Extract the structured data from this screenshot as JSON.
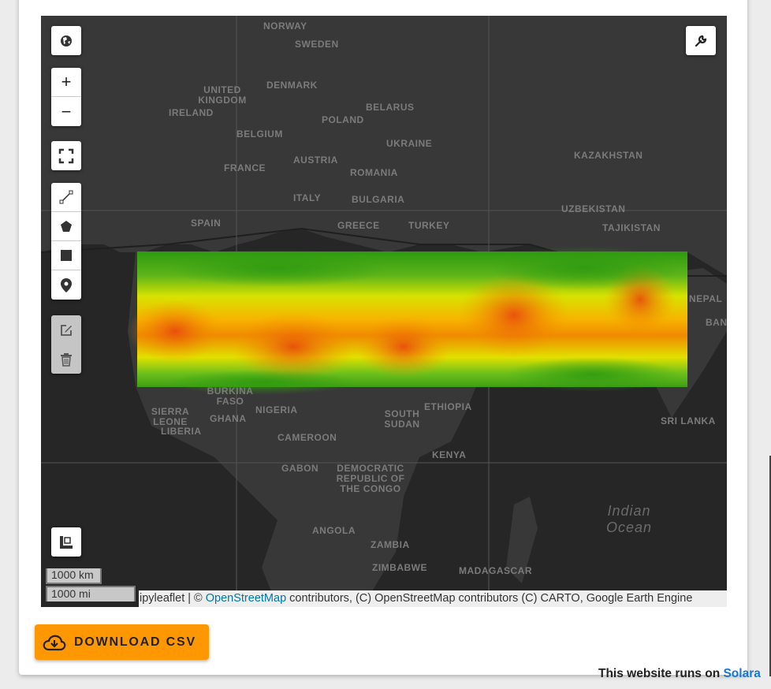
{
  "map": {
    "country_labels": [
      {
        "name": "NORWAY"
      },
      {
        "name": "SWEDEN"
      },
      {
        "name": "UNITED KINGDOM"
      },
      {
        "name": "DENMARK"
      },
      {
        "name": "IRELAND"
      },
      {
        "name": "BELARUS"
      },
      {
        "name": "POLAND"
      },
      {
        "name": "BELGIUM"
      },
      {
        "name": "UKRAINE"
      },
      {
        "name": "KAZAKHSTAN"
      },
      {
        "name": "AUSTRIA"
      },
      {
        "name": "FRANCE"
      },
      {
        "name": "ROMANIA"
      },
      {
        "name": "ITALY"
      },
      {
        "name": "BULGARIA"
      },
      {
        "name": "UZBEKISTAN"
      },
      {
        "name": "SPAIN"
      },
      {
        "name": "GREECE"
      },
      {
        "name": "TURKEY"
      },
      {
        "name": "TAJIKISTAN"
      },
      {
        "name": "NEPAL"
      },
      {
        "name": "BAN"
      },
      {
        "name": "BURKINA FASO"
      },
      {
        "name": "SIERRA LEONE"
      },
      {
        "name": "LIBERIA"
      },
      {
        "name": "GHANA"
      },
      {
        "name": "NIGERIA"
      },
      {
        "name": "ETHIOPIA"
      },
      {
        "name": "SOUTH SUDAN"
      },
      {
        "name": "CAMEROON"
      },
      {
        "name": "SRI LANKA"
      },
      {
        "name": "KENYA"
      },
      {
        "name": "GABON"
      },
      {
        "name": "DEMOCRATIC REPUBLIC OF THE CONGO"
      },
      {
        "name": "ANGOLA"
      },
      {
        "name": "ZAMBIA"
      },
      {
        "name": "ZIMBABWE"
      },
      {
        "name": "MADAGASCAR"
      }
    ],
    "ocean_label": "Indian Ocean",
    "scale_km": "1000 km",
    "scale_mi": "1000 mi",
    "attribution_prefix": "ipyleaflet | © ",
    "attribution_link": "OpenStreetMap",
    "attribution_suffix": " contributors, (C) OpenStreetMap contributors (C) CARTO, Google Earth Engine"
  },
  "controls": {
    "zoom_in": "+",
    "zoom_out": "−"
  },
  "download_label": "DOWNLOAD CSV",
  "footer": {
    "text": "This website runs on ",
    "link": "Solara"
  },
  "colors": {
    "accent": "#ff9800",
    "link": "#1976d2",
    "map_bg": "#262626",
    "land": "#3a3a3a"
  }
}
